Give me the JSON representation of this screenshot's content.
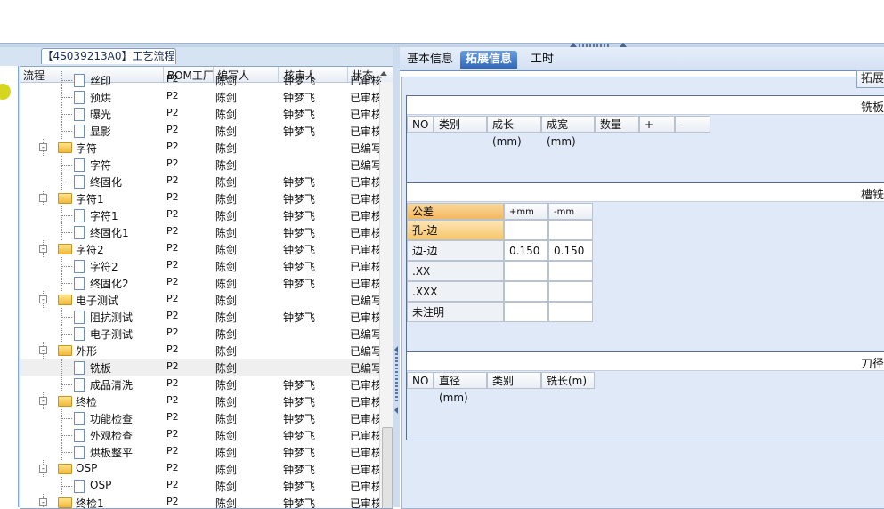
{
  "left_panel": {
    "tab_title": "【4S039213A0】工艺流程",
    "columns": [
      "流程",
      "BOM工厂",
      "编写人",
      "核审人",
      "状态"
    ],
    "rows": [
      {
        "name": "丝印",
        "level": 2,
        "type": "doc",
        "bom": "P2",
        "writer": "陈剑",
        "reviewer": "钟梦飞",
        "status": "已审核"
      },
      {
        "name": "预烘",
        "level": 2,
        "type": "doc",
        "bom": "P2",
        "writer": "陈剑",
        "reviewer": "钟梦飞",
        "status": "已审核"
      },
      {
        "name": "曝光",
        "level": 2,
        "type": "doc",
        "bom": "P2",
        "writer": "陈剑",
        "reviewer": "钟梦飞",
        "status": "已审核"
      },
      {
        "name": "显影",
        "level": 2,
        "type": "doc",
        "bom": "P2",
        "writer": "陈剑",
        "reviewer": "钟梦飞",
        "status": "已审核"
      },
      {
        "name": "字符",
        "level": 1,
        "type": "folder",
        "bom": "P2",
        "writer": "陈剑",
        "reviewer": "",
        "status": "已编写"
      },
      {
        "name": "字符",
        "level": 2,
        "type": "doc",
        "bom": "P2",
        "writer": "陈剑",
        "reviewer": "",
        "status": "已编写"
      },
      {
        "name": "终固化",
        "level": 2,
        "type": "doc",
        "bom": "P2",
        "writer": "陈剑",
        "reviewer": "钟梦飞",
        "status": "已审核"
      },
      {
        "name": "字符1",
        "level": 1,
        "type": "folder",
        "bom": "P2",
        "writer": "陈剑",
        "reviewer": "钟梦飞",
        "status": "已审核"
      },
      {
        "name": "字符1",
        "level": 2,
        "type": "doc",
        "bom": "P2",
        "writer": "陈剑",
        "reviewer": "钟梦飞",
        "status": "已审核"
      },
      {
        "name": "终固化1",
        "level": 2,
        "type": "doc",
        "bom": "P2",
        "writer": "陈剑",
        "reviewer": "钟梦飞",
        "status": "已审核"
      },
      {
        "name": "字符2",
        "level": 1,
        "type": "folder",
        "bom": "P2",
        "writer": "陈剑",
        "reviewer": "钟梦飞",
        "status": "已审核"
      },
      {
        "name": "字符2",
        "level": 2,
        "type": "doc",
        "bom": "P2",
        "writer": "陈剑",
        "reviewer": "钟梦飞",
        "status": "已审核"
      },
      {
        "name": "终固化2",
        "level": 2,
        "type": "doc",
        "bom": "P2",
        "writer": "陈剑",
        "reviewer": "钟梦飞",
        "status": "已审核"
      },
      {
        "name": "电子测试",
        "level": 1,
        "type": "folder",
        "bom": "P2",
        "writer": "陈剑",
        "reviewer": "",
        "status": "已编写"
      },
      {
        "name": "阻抗测试",
        "level": 2,
        "type": "doc",
        "bom": "P2",
        "writer": "陈剑",
        "reviewer": "钟梦飞",
        "status": "已审核"
      },
      {
        "name": "电子测试",
        "level": 2,
        "type": "doc",
        "bom": "P2",
        "writer": "陈剑",
        "reviewer": "",
        "status": "已编写"
      },
      {
        "name": "外形",
        "level": 1,
        "type": "folder",
        "bom": "P2",
        "writer": "陈剑",
        "reviewer": "",
        "status": "已编写"
      },
      {
        "name": "铣板",
        "level": 2,
        "type": "doc",
        "bom": "P2",
        "writer": "陈剑",
        "reviewer": "",
        "status": "已编写",
        "selected": true
      },
      {
        "name": "成品清洗",
        "level": 2,
        "type": "doc",
        "bom": "P2",
        "writer": "陈剑",
        "reviewer": "钟梦飞",
        "status": "已审核"
      },
      {
        "name": "终检",
        "level": 1,
        "type": "folder",
        "bom": "P2",
        "writer": "陈剑",
        "reviewer": "钟梦飞",
        "status": "已审核"
      },
      {
        "name": "功能检查",
        "level": 2,
        "type": "doc",
        "bom": "P2",
        "writer": "陈剑",
        "reviewer": "钟梦飞",
        "status": "已审核"
      },
      {
        "name": "外观检查",
        "level": 2,
        "type": "doc",
        "bom": "P2",
        "writer": "陈剑",
        "reviewer": "钟梦飞",
        "status": "已审核"
      },
      {
        "name": "烘板整平",
        "level": 2,
        "type": "doc",
        "bom": "P2",
        "writer": "陈剑",
        "reviewer": "钟梦飞",
        "status": "已审核"
      },
      {
        "name": "OSP",
        "level": 1,
        "type": "folder",
        "bom": "P2",
        "writer": "陈剑",
        "reviewer": "钟梦飞",
        "status": "已审核"
      },
      {
        "name": "OSP",
        "level": 2,
        "type": "doc",
        "bom": "P2",
        "writer": "陈剑",
        "reviewer": "钟梦飞",
        "status": "已审核"
      },
      {
        "name": "终检1",
        "level": 1,
        "type": "folder",
        "bom": "P2",
        "writer": "陈剑",
        "reviewer": "钟梦飞",
        "status": "已审核"
      }
    ]
  },
  "right_panel": {
    "tabs": [
      "基本信息",
      "拓展信息",
      "工时"
    ],
    "active_tab": 1,
    "side_button": "拓展",
    "section1": {
      "title": "铣板",
      "columns": [
        "NO",
        "类别",
        "成长(mm)",
        "成宽(mm)",
        "数量",
        "+",
        "-"
      ]
    },
    "section2": {
      "title": "槽铣",
      "columns": [
        "公差",
        "+mm",
        "-mm"
      ],
      "rows": [
        {
          "label": "孔-边",
          "plus": "",
          "minus": ""
        },
        {
          "label": "边-边",
          "plus": "0.150",
          "minus": "0.150"
        },
        {
          "label": ".XX",
          "plus": "",
          "minus": ""
        },
        {
          "label": ".XXX",
          "plus": "",
          "minus": ""
        },
        {
          "label": "未注明",
          "plus": "",
          "minus": ""
        }
      ]
    },
    "section3": {
      "title": "刀径",
      "columns": [
        "NO",
        "直径(mm)",
        "类别",
        "铣长(m)"
      ]
    }
  }
}
